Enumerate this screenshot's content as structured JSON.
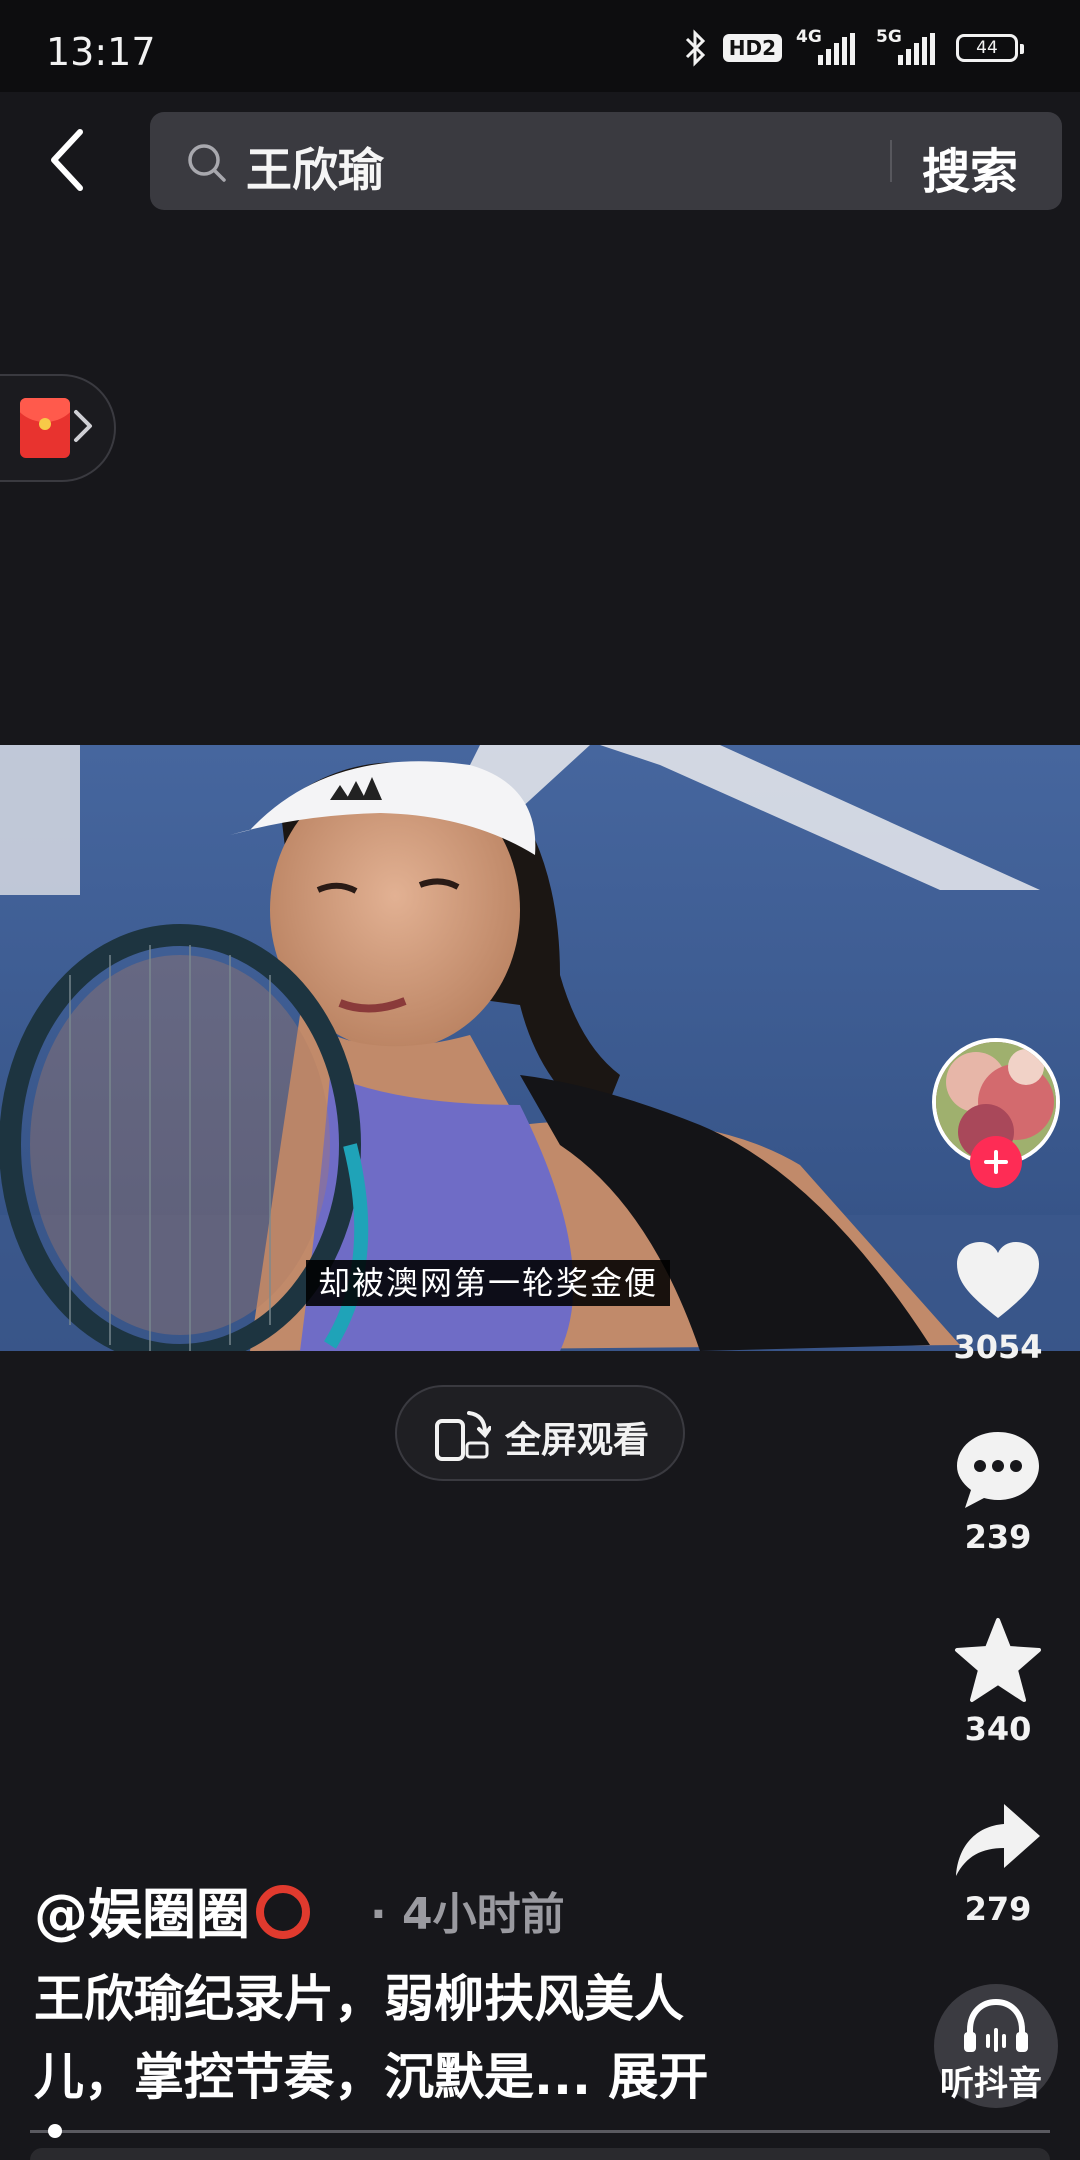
{
  "status_bar": {
    "time": "13:17",
    "hd_label": "HD2",
    "network_1": "4G",
    "network_2": "5G",
    "battery": "44"
  },
  "search": {
    "query": "王欣瑜",
    "button_label": "搜索"
  },
  "video": {
    "subtitle": "却被澳网第一轮奖金便",
    "fullscreen_label": "全屏观看"
  },
  "actions": {
    "likes": "3054",
    "comments": "239",
    "favorites": "340",
    "shares": "279",
    "listen_label": "听抖音"
  },
  "post": {
    "author": "@娱圈圈",
    "time_ago": "· 4小时前",
    "description": "王欣瑜纪录片，弱柳扶风美人儿，掌控节奏，沉默是...",
    "expand_label": "展开"
  },
  "colors": {
    "accent": "#fe2c55",
    "background": "#17171b"
  }
}
